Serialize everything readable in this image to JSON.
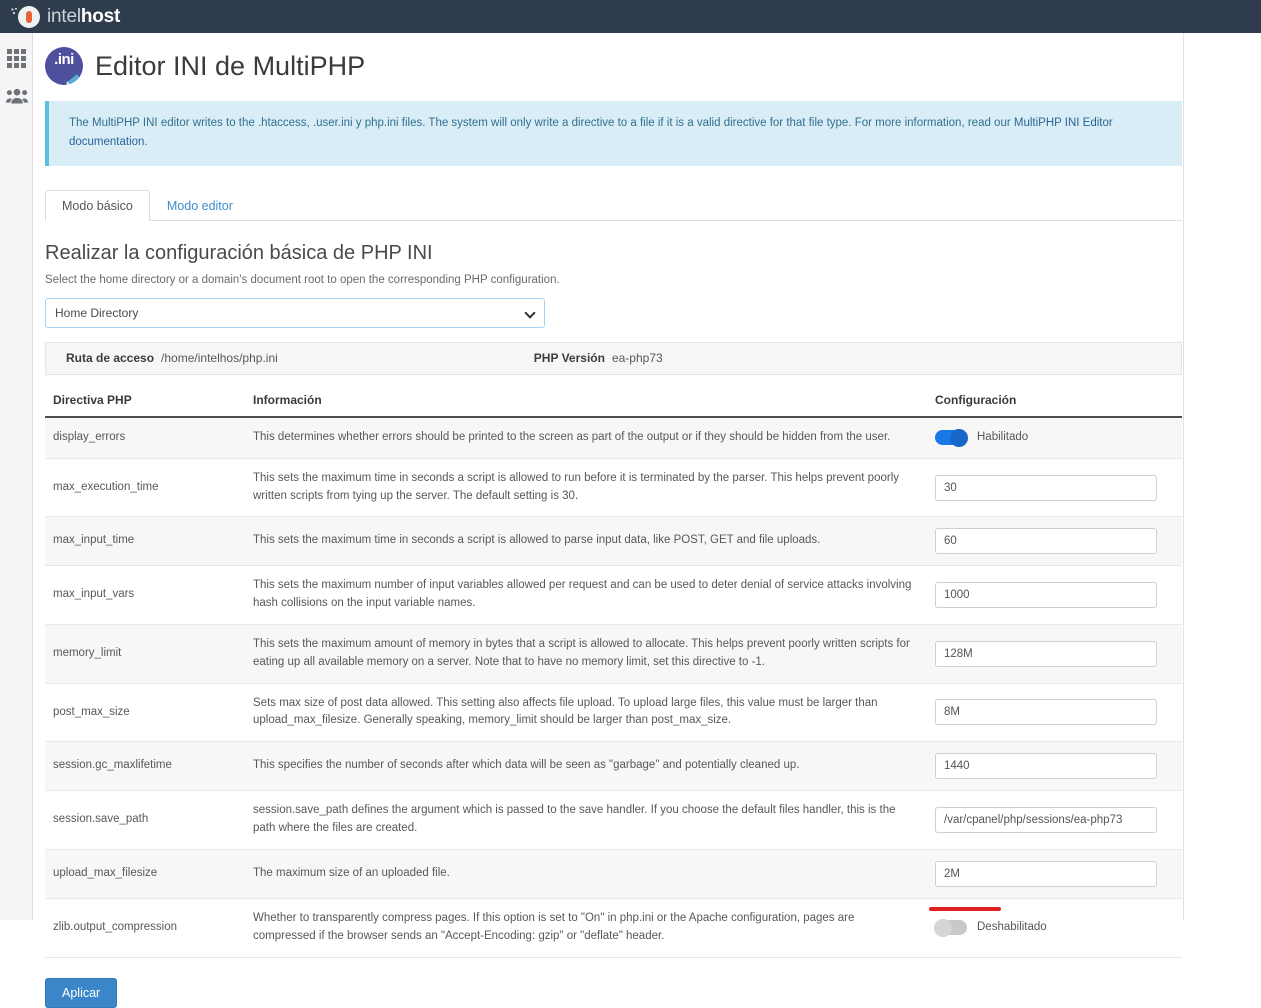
{
  "brand": {
    "name_light": "intel",
    "name_bold": "host",
    "logo_icon": "intelhost-circle-icon"
  },
  "rail": {
    "items": [
      {
        "icon": "grid-apps-icon",
        "name": "apps"
      },
      {
        "icon": "users-group-icon",
        "name": "users"
      }
    ]
  },
  "page": {
    "icon": "ini-file-edit-icon",
    "icon_text": ".ini",
    "title": "Editor INI de MultiPHP"
  },
  "notice": {
    "text_before_link": "The MultiPHP INI editor writes to the .htaccess, .user.ini y php.ini files. The system will only write a directive to a file if it is a valid directive for that file type. For more information, read our ",
    "link_text": "MultiPHP INI Editor documentation",
    "text_after_link": "."
  },
  "tabs": [
    {
      "label": "Modo básico",
      "active": true
    },
    {
      "label": "Modo editor",
      "active": false
    }
  ],
  "section": {
    "title": "Realizar la configuración básica de PHP INI",
    "subtitle": "Select the home directory or a domain's document root to open the corresponding PHP configuration."
  },
  "directory_select": {
    "selected": "Home Directory",
    "options": [
      "Home Directory"
    ]
  },
  "info_strip": {
    "path_label": "Ruta de acceso",
    "path_value": "/home/intelhos/php.ini",
    "version_label": "PHP Versión",
    "version_value": "ea-php73"
  },
  "table": {
    "headers": {
      "directive": "Directiva PHP",
      "information": "Información",
      "configuration": "Configuración"
    },
    "rows": [
      {
        "directive": "display_errors",
        "information": "This determines whether errors should be printed to the screen as part of the output or if they should be hidden from the user.",
        "control": "toggle",
        "toggle_state": "on",
        "value": "Habilitado",
        "annotated": false
      },
      {
        "directive": "max_execution_time",
        "information": "This sets the maximum time in seconds a script is allowed to run before it is terminated by the parser. This helps prevent poorly written scripts from tying up the server. The default setting is 30.",
        "control": "input",
        "value": "30",
        "annotated": false
      },
      {
        "directive": "max_input_time",
        "information": "This sets the maximum time in seconds a script is allowed to parse input data, like POST, GET and file uploads.",
        "control": "input",
        "value": "60",
        "annotated": false
      },
      {
        "directive": "max_input_vars",
        "information": "This sets the maximum number of input variables allowed per request and can be used to deter denial of service attacks involving hash collisions on the input variable names.",
        "control": "input",
        "value": "1000",
        "annotated": false
      },
      {
        "directive": "memory_limit",
        "information": "This sets the maximum amount of memory in bytes that a script is allowed to allocate. This helps prevent poorly written scripts for eating up all available memory on a server. Note that to have no memory limit, set this directive to -1.",
        "control": "input",
        "value": "128M",
        "annotated": false
      },
      {
        "directive": "post_max_size",
        "information": "Sets max size of post data allowed. This setting also affects file upload. To upload large files, this value must be larger than upload_max_filesize. Generally speaking, memory_limit should be larger than post_max_size.",
        "control": "input",
        "value": "8M",
        "annotated": false
      },
      {
        "directive": "session.gc_maxlifetime",
        "information": "This specifies the number of seconds after which data will be seen as \"garbage\" and potentially cleaned up.",
        "control": "input",
        "value": "1440",
        "annotated": false
      },
      {
        "directive": "session.save_path",
        "information": "session.save_path defines the argument which is passed to the save handler. If you choose the default files handler, this is the path where the files are created.",
        "control": "input",
        "value": "/var/cpanel/php/sessions/ea-php73",
        "annotated": false
      },
      {
        "directive": "upload_max_filesize",
        "information": "The maximum size of an uploaded file.",
        "control": "input",
        "value": "2M",
        "annotated": true
      },
      {
        "directive": "zlib.output_compression",
        "information": "Whether to transparently compress pages. If this option is set to \"On\" in php.ini or the Apache configuration, pages are compressed if the browser sends an \"Accept-Encoding: gzip\" or \"deflate\" header.",
        "control": "toggle",
        "toggle_state": "off",
        "value": "Deshabilitado",
        "annotated": false
      }
    ]
  },
  "apply_button": {
    "label": "Aplicar"
  },
  "colors": {
    "topbar": "#2e3c4d",
    "notice_bg": "#d9edf7",
    "notice_border": "#5bc0de",
    "accent_link": "#3e8dcc",
    "toggle_on": "#1878e6",
    "toggle_off": "#c9c9c9",
    "annotation_red": "#e02020",
    "apply_blue": "#3b86c8",
    "ini_icon_purple": "#4f4f9e",
    "logo_orange": "#e8633a"
  }
}
